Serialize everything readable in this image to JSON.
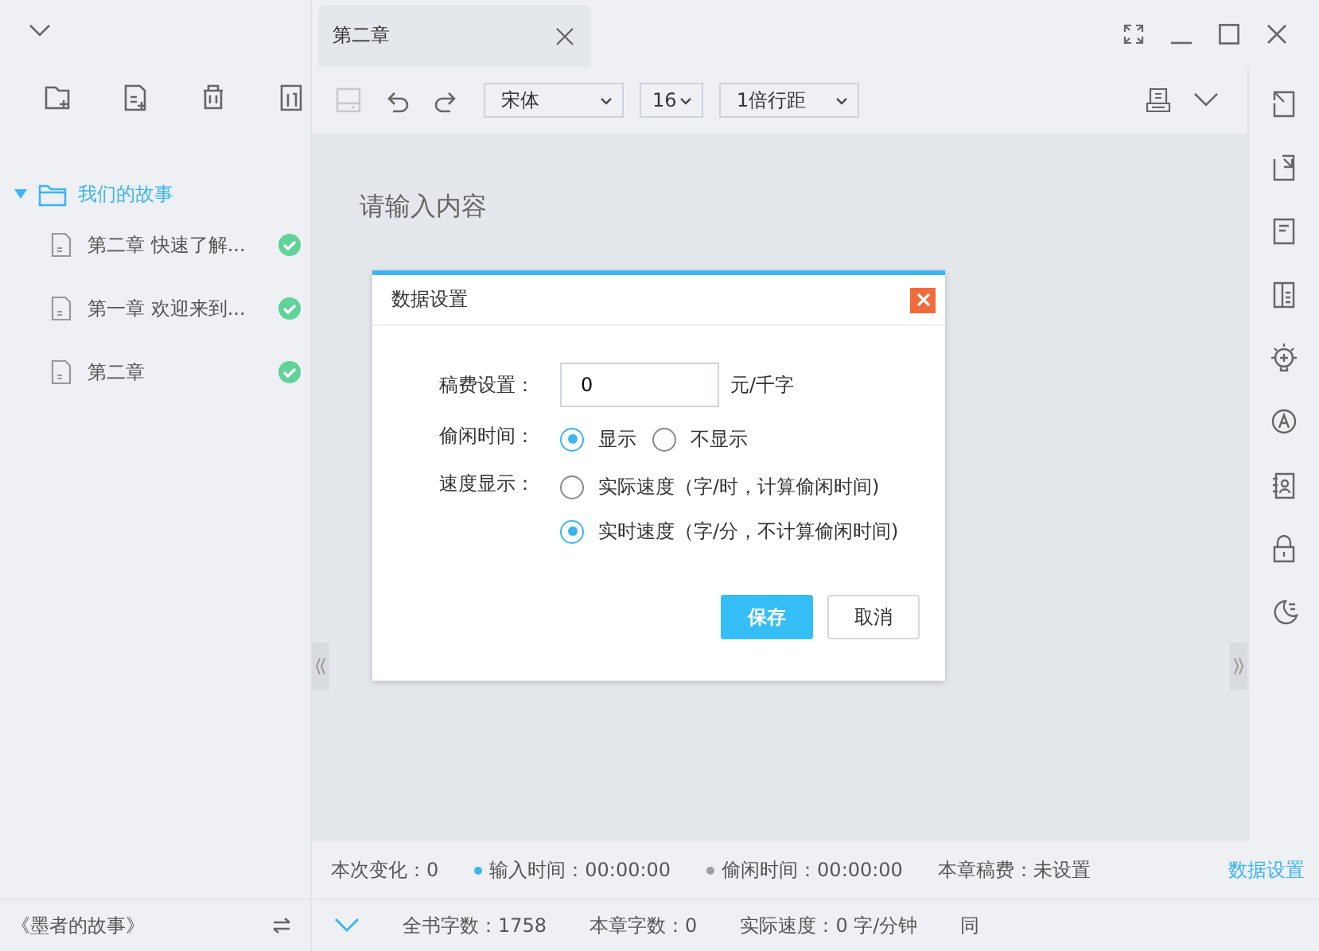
{
  "sidebar": {
    "tree": [
      {
        "label": "我们的故事",
        "expanded": true,
        "children": [
          {
            "label": "第二章 快速了解...",
            "done": true
          },
          {
            "label": "第一章 欢迎来到...",
            "done": true
          },
          {
            "label": "第二章",
            "done": true
          }
        ]
      }
    ],
    "book_title": "《墨者的故事》"
  },
  "tabs": [
    {
      "label": "第二章",
      "selected": true
    }
  ],
  "toolbar": {
    "font": "宋体",
    "size": "16",
    "line_spacing": "1倍行距"
  },
  "editor": {
    "placeholder": "请输入内容"
  },
  "dialog": {
    "title": "数据设置",
    "fee": {
      "label": "稿费设置：",
      "value": "0",
      "unit": "元/千字"
    },
    "idle": {
      "label": "偷闲时间：",
      "options": [
        {
          "label": "显示",
          "selected": true
        },
        {
          "label": "不显示",
          "selected": false
        }
      ]
    },
    "speed": {
      "label": "速度显示：",
      "options": [
        {
          "label": "实际速度（字/时，计算偷闲时间)",
          "selected": false
        },
        {
          "label": "实时速度（字/分，不计算偷闲时间)",
          "selected": true
        }
      ]
    },
    "buttons": [
      {
        "label": "保存",
        "kind": "primary"
      },
      {
        "label": "取消",
        "kind": "secondary"
      }
    ]
  },
  "status_bar": {
    "row_1": [
      {
        "text": "本次变化：0"
      },
      {
        "text": "输入时间：00:00:00",
        "color": "#3cb4f0"
      },
      {
        "text": "偷闲时间：00:00:00",
        "color": "#a0a0a0"
      },
      {
        "text": "本章稿费：未设置"
      }
    ],
    "link": "数据设置",
    "row_2": [
      {
        "text": "全书字数：1758"
      },
      {
        "text": "本章字数：0"
      },
      {
        "text": "实际速度：0 字/分钟"
      },
      {
        "text": "同"
      }
    ]
  }
}
